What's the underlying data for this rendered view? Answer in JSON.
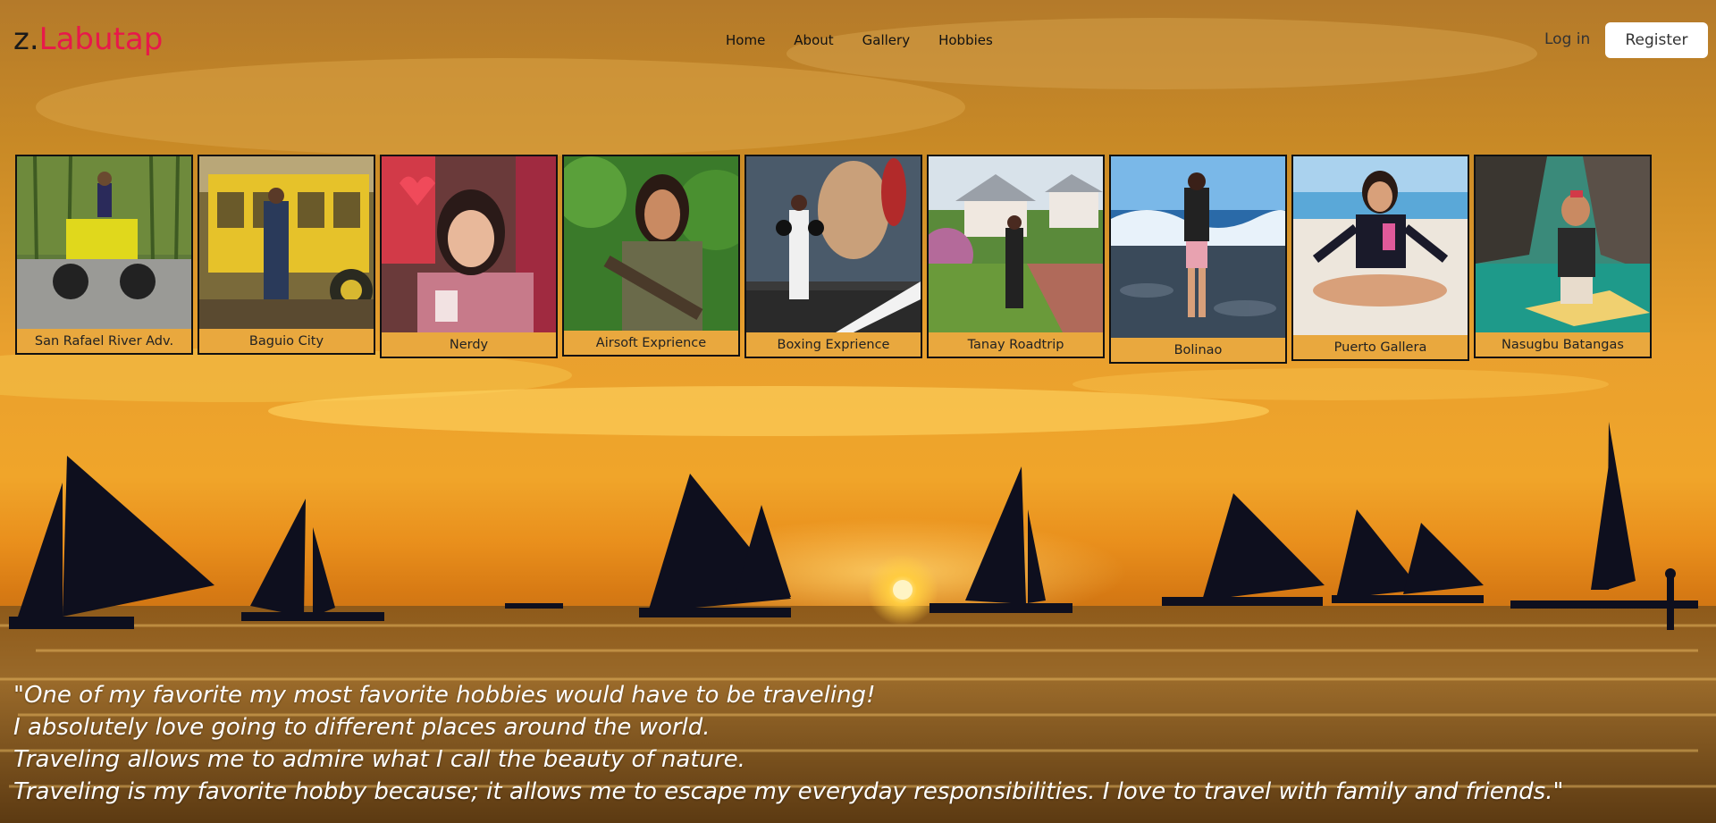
{
  "header": {
    "logo_prefix": "z.",
    "logo_main": "Labutap",
    "nav": [
      "Home",
      "About",
      "Gallery",
      "Hobbies"
    ],
    "login": "Log in",
    "register": "Register"
  },
  "gallery": [
    {
      "caption": "San Rafael River Adv.",
      "scene": "atv-bamboo"
    },
    {
      "caption": "Baguio City",
      "scene": "yellow-jeep"
    },
    {
      "caption": "Nerdy",
      "scene": "cafe"
    },
    {
      "caption": "Airsoft Exprience",
      "scene": "airsoft"
    },
    {
      "caption": "Boxing Exprience",
      "scene": "boxing-mural"
    },
    {
      "caption": "Tanay Roadtrip",
      "scene": "houses"
    },
    {
      "caption": "Bolinao",
      "scene": "sea-waves"
    },
    {
      "caption": "Puerto Gallera",
      "scene": "beach-sitting"
    },
    {
      "caption": "Nasugbu Batangas",
      "scene": "cove-boat"
    }
  ],
  "quote": [
    "\"One of my favorite my most favorite hobbies would have to be traveling!",
    "I absolutely love going to different places around the world.",
    "Traveling allows me to admire what I call the beauty of nature.",
    "Traveling is my favorite hobby because; it allows me to escape my everyday responsibilities. I love to travel with family and friends.\""
  ],
  "colors": {
    "brand": "#e8194a",
    "card_caption_bg": "#e9a83e",
    "sky_top": "#b87a22",
    "sunset_glow": "#f6b63a"
  }
}
